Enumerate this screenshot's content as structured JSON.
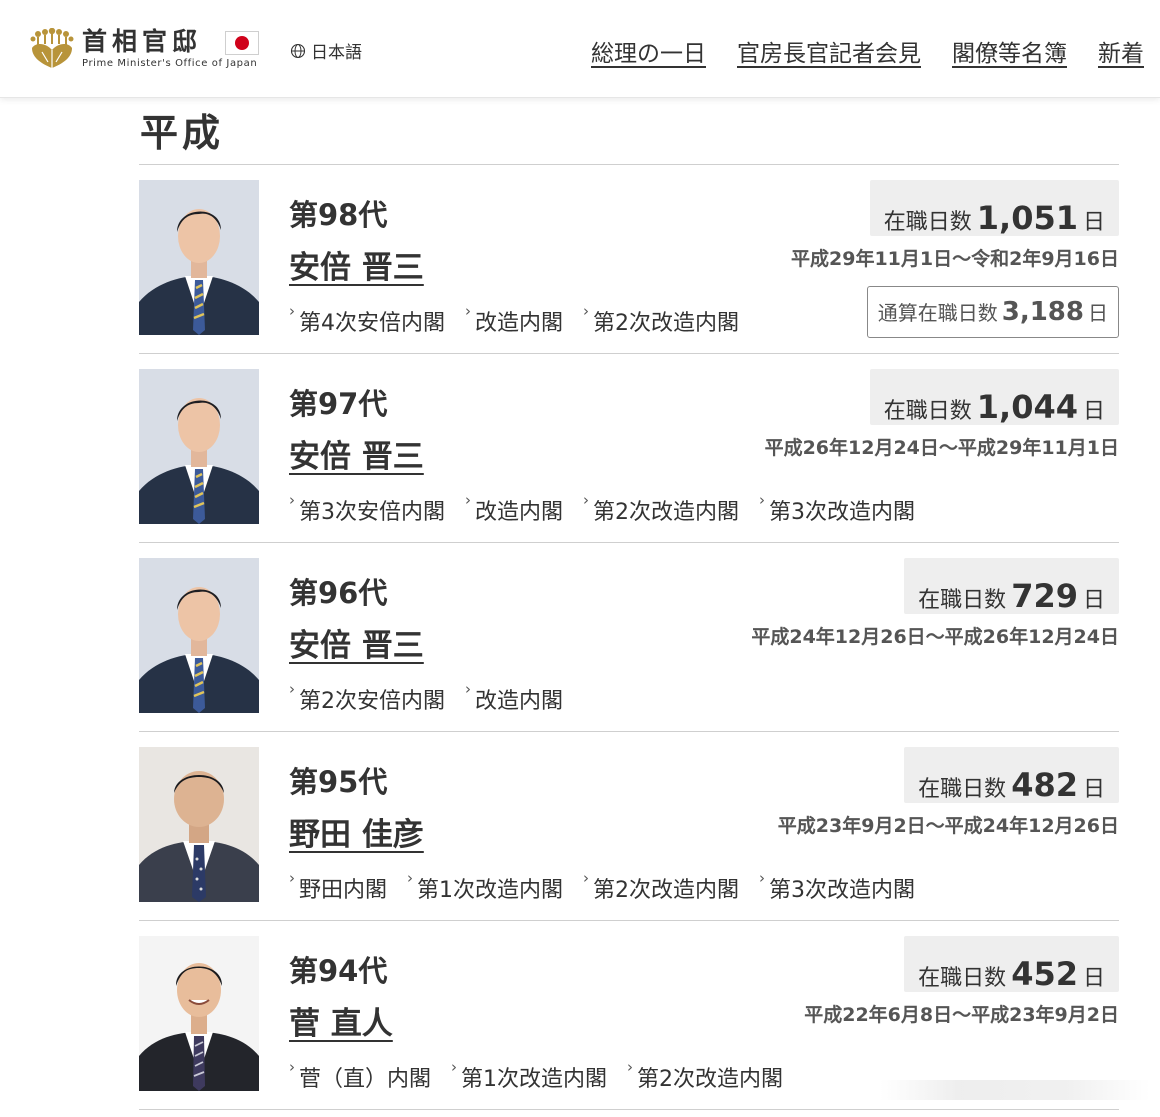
{
  "header": {
    "logo_title": "首相官邸",
    "logo_subtitle": "Prime Minister's Office of Japan",
    "language_label": "日本語",
    "nav": [
      {
        "label": "総理の一日"
      },
      {
        "label": "官房長官記者会見"
      },
      {
        "label": "閣僚等名簿"
      },
      {
        "label": "新着"
      }
    ]
  },
  "era_title": "平成",
  "prime_ministers": [
    {
      "generation": "第98代",
      "name": "安倍 晋三",
      "days_label": "在職日数",
      "days": "1,051",
      "days_unit": "日",
      "period": "平成29年11月1日〜令和2年9月16日",
      "cabinets": [
        "第4次安倍内閣",
        "改造内閣",
        "第2次改造内閣"
      ],
      "total_label": "通算在職日数",
      "total_days": "3,188",
      "total_unit": "日"
    },
    {
      "generation": "第97代",
      "name": "安倍 晋三",
      "days_label": "在職日数",
      "days": "1,044",
      "days_unit": "日",
      "period": "平成26年12月24日〜平成29年11月1日",
      "cabinets": [
        "第3次安倍内閣",
        "改造内閣",
        "第2次改造内閣",
        "第3次改造内閣"
      ]
    },
    {
      "generation": "第96代",
      "name": "安倍 晋三",
      "days_label": "在職日数",
      "days": "729",
      "days_unit": "日",
      "period": "平成24年12月26日〜平成26年12月24日",
      "cabinets": [
        "第2次安倍内閣",
        "改造内閣"
      ]
    },
    {
      "generation": "第95代",
      "name": "野田 佳彦",
      "days_label": "在職日数",
      "days": "482",
      "days_unit": "日",
      "period": "平成23年9月2日〜平成24年12月26日",
      "cabinets": [
        "野田内閣",
        "第1次改造内閣",
        "第2次改造内閣",
        "第3次改造内閣"
      ]
    },
    {
      "generation": "第94代",
      "name": "菅 直人",
      "days_label": "在職日数",
      "days": "452",
      "days_unit": "日",
      "period": "平成22年6月8日〜平成23年9月2日",
      "cabinets": [
        "菅（直）内閣",
        "第1次改造内閣",
        "第2次改造内閣"
      ]
    }
  ],
  "colors": {
    "text": "#333333",
    "badge_bg": "#eeeeee",
    "flag_red": "#d0021b",
    "emblem_gold": "#b8943a"
  },
  "icons": {
    "language": "globe-icon",
    "language_toggle": "chevron-down-icon",
    "cabinet_link": "chevron-right-icon",
    "logo": "paulownia-emblem-icon"
  }
}
